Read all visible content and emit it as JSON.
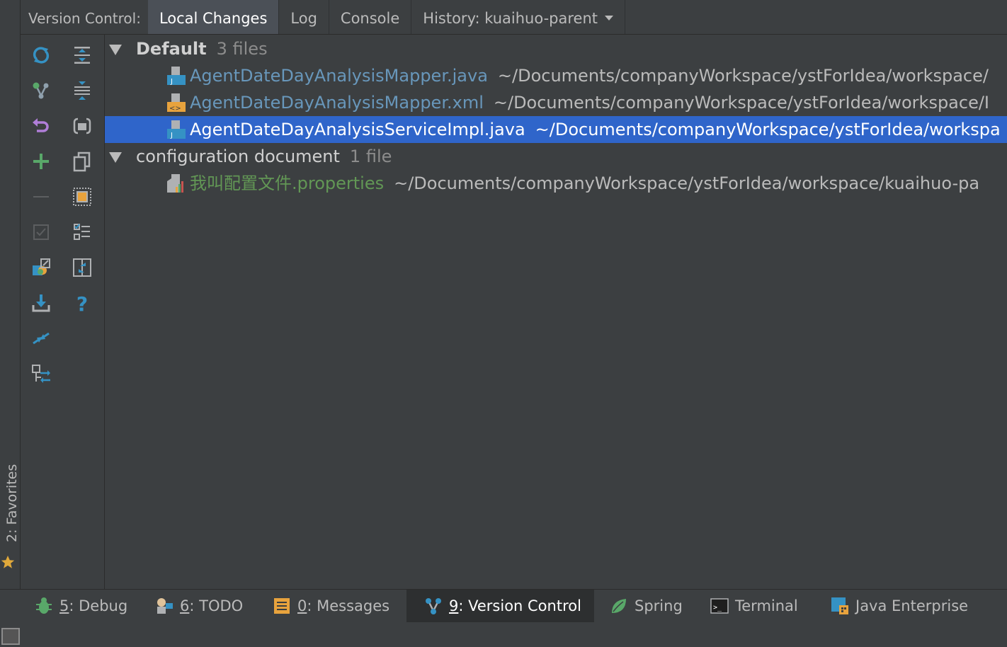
{
  "header": {
    "title": "Version Control:",
    "tabs": [
      {
        "label": "Local Changes",
        "active": true
      },
      {
        "label": "Log",
        "active": false
      },
      {
        "label": "Console",
        "active": false
      },
      {
        "label": "History: kuaihuo-parent",
        "active": false
      }
    ]
  },
  "favorites": {
    "label": "2: Favorites"
  },
  "toolbar": {
    "icons": [
      "refresh-icon",
      "commit-icon",
      "rollback-icon",
      "add-icon",
      "remove-icon",
      "checkbox-icon",
      "shelve-icon",
      "update-icon",
      "merge-icon",
      "move-icon",
      "expand-all-icon",
      "collapse-all-icon",
      "group-icon",
      "copy-icon",
      "preview-icon",
      "list-icon",
      "diff-icon",
      "help-icon"
    ]
  },
  "tree": {
    "groups": [
      {
        "name": "Default",
        "count": "3 files",
        "files": [
          {
            "name": "AgentDateDayAnalysisMapper.java",
            "path": "~/Documents/companyWorkspace/ystForIdea/workspace/",
            "type": "java",
            "color": "#6897bb",
            "selected": false
          },
          {
            "name": "AgentDateDayAnalysisMapper.xml",
            "path": "~/Documents/companyWorkspace/ystForIdea/workspace/I",
            "type": "xml",
            "color": "#6897bb",
            "selected": false
          },
          {
            "name": "AgentDateDayAnalysisServiceImpl.java",
            "path": "~/Documents/companyWorkspace/ystForIdea/workspa",
            "type": "java",
            "color": "#ffffff",
            "selected": true
          }
        ]
      },
      {
        "name": "configuration document",
        "count": "1 file",
        "files": [
          {
            "name": "我叫配置文件.properties",
            "path": "~/Documents/companyWorkspace/ystForIdea/workspace/kuaihuo-pa",
            "type": "properties",
            "color": "#629755",
            "selected": false
          }
        ]
      }
    ]
  },
  "bottombar": {
    "items": [
      {
        "mnemonic": "5",
        "label": ": Debug"
      },
      {
        "mnemonic": "6",
        "label": ": TODO"
      },
      {
        "mnemonic": "0",
        "label": ": Messages"
      },
      {
        "mnemonic": "9",
        "label": ": Version Control",
        "active": true
      },
      {
        "mnemonic": "",
        "label": "Spring"
      },
      {
        "mnemonic": "",
        "label": "Terminal"
      },
      {
        "mnemonic": "",
        "label": "Java Enterprise"
      }
    ]
  },
  "colors": {
    "background": "#3c3f41",
    "selection": "#2f65ca",
    "file_blue": "#6897bb",
    "file_green": "#629755"
  }
}
